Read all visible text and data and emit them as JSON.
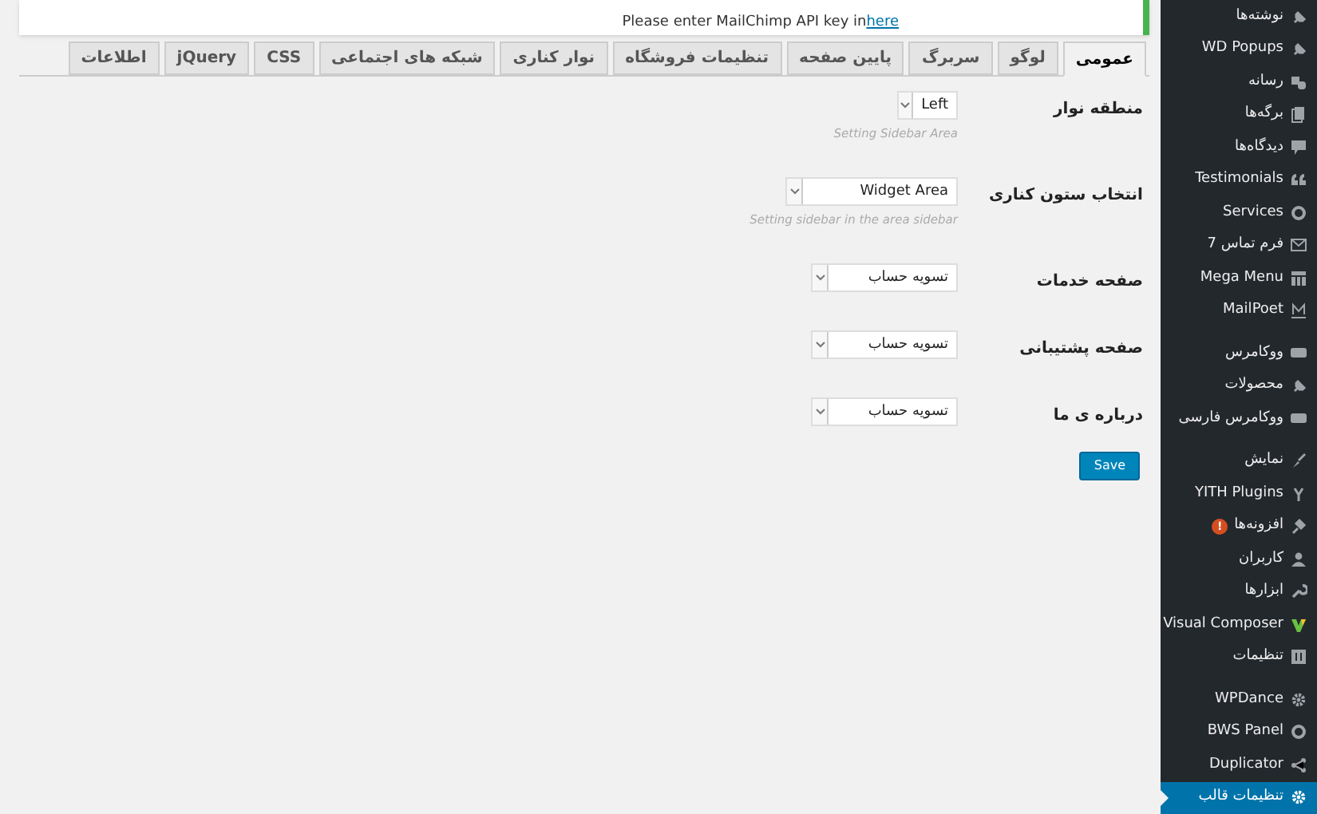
{
  "notice": {
    "text": "Please enter MailChimp API key in",
    "link": "here"
  },
  "tabs": [
    {
      "label": "عمومی",
      "selected": true
    },
    {
      "label": "لوگو",
      "selected": false
    },
    {
      "label": "سربرگ",
      "selected": false
    },
    {
      "label": "پایین صفحه",
      "selected": false
    },
    {
      "label": "تنظیمات فروشگاه",
      "selected": false
    },
    {
      "label": "نوار کناری",
      "selected": false
    },
    {
      "label": "شبکه های اجتماعی",
      "selected": false
    },
    {
      "label": "CSS",
      "selected": false
    },
    {
      "label": "jQuery",
      "selected": false
    },
    {
      "label": "اطلاعات",
      "selected": false
    }
  ],
  "fields": [
    {
      "label": "منطقه نوار",
      "value": "Left",
      "hint": "Setting Sidebar Area"
    },
    {
      "label": "انتخاب ستون کناری",
      "value": "Widget Area",
      "hint": "Setting sidebar in the area sidebar"
    },
    {
      "label": "صفحه خدمات",
      "value": "تسویه حساب"
    },
    {
      "label": "صفحه پشتیبانی",
      "value": "تسویه حساب"
    },
    {
      "label": "درباره ی ما",
      "value": "تسویه حساب"
    }
  ],
  "save_button": "Save",
  "sidebar": {
    "groups": [
      [
        {
          "label": "نوشته‌ها",
          "selected": false
        },
        {
          "label": "WD Popups",
          "selected": false
        },
        {
          "label": "رسانه",
          "selected": false
        },
        {
          "label": "برگه‌ها",
          "selected": false
        },
        {
          "label": "دیدگاه‌ها",
          "selected": false
        },
        {
          "label": "Testimonials",
          "selected": false
        },
        {
          "label": "Services",
          "selected": false
        },
        {
          "label": "فرم تماس 7",
          "selected": false
        },
        {
          "label": "Mega Menu",
          "selected": false
        },
        {
          "label": "MailPoet",
          "selected": false
        }
      ],
      [
        {
          "label": "ووکامرس",
          "selected": false
        },
        {
          "label": "محصولات",
          "selected": false
        },
        {
          "label": "ووکامرس فارسی",
          "selected": false
        }
      ],
      [
        {
          "label": "نمایش",
          "selected": false
        },
        {
          "label": "YITH Plugins",
          "selected": false
        },
        {
          "label": "افزونه‌ها",
          "badge": "!",
          "selected": false
        },
        {
          "label": "کاربران",
          "selected": false
        },
        {
          "label": "ابزارها",
          "selected": false
        },
        {
          "label": "Visual Composer",
          "selected": false
        },
        {
          "label": "تنظیمات",
          "selected": false
        }
      ],
      [
        {
          "label": "WPDance",
          "selected": false
        },
        {
          "label": "BWS Panel",
          "selected": false
        },
        {
          "label": "Duplicator",
          "selected": false
        },
        {
          "label": "تنظیمات قالب",
          "selected": true
        }
      ]
    ]
  }
}
